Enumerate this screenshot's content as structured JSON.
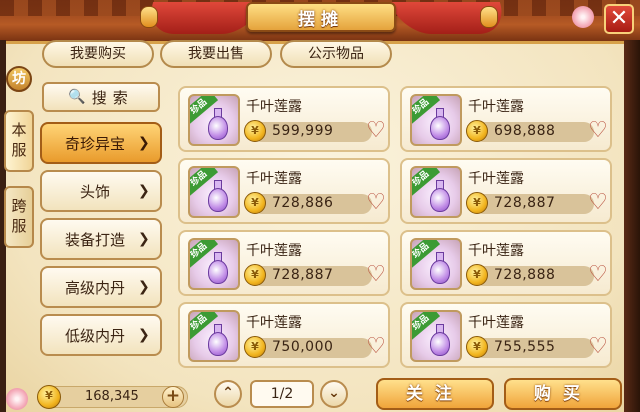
{
  "window": {
    "title": "摆摊",
    "close": "✕"
  },
  "top_tabs": [
    {
      "label": "我要购买"
    },
    {
      "label": "我要出售"
    },
    {
      "label": "公示物品"
    }
  ],
  "side_tabs": {
    "badge": "坊",
    "server": "本服",
    "cross_server": "跨服"
  },
  "search": {
    "label": "搜索"
  },
  "categories": [
    {
      "label": "奇珍异宝",
      "active": true
    },
    {
      "label": "头饰",
      "active": false
    },
    {
      "label": "装备打造",
      "active": false
    },
    {
      "label": "高级内丹",
      "active": false
    },
    {
      "label": "低级内丹",
      "active": false
    }
  ],
  "items": [
    {
      "name": "千叶莲露",
      "tag": "珍品",
      "price": "599,999"
    },
    {
      "name": "千叶莲露",
      "tag": "珍品",
      "price": "698,888"
    },
    {
      "name": "千叶莲露",
      "tag": "珍品",
      "price": "728,886"
    },
    {
      "name": "千叶莲露",
      "tag": "珍品",
      "price": "728,887"
    },
    {
      "name": "千叶莲露",
      "tag": "珍品",
      "price": "728,887"
    },
    {
      "name": "千叶莲露",
      "tag": "珍品",
      "price": "728,888"
    },
    {
      "name": "千叶莲露",
      "tag": "珍品",
      "price": "750,000"
    },
    {
      "name": "千叶莲露",
      "tag": "珍品",
      "price": "755,555"
    }
  ],
  "footer": {
    "money": "168,345",
    "page": "1/2",
    "follow_label": "关注",
    "buy_label": "购买"
  },
  "colors": {
    "accent": "#f0a43a",
    "heart": "#b9523f",
    "tag": "#3c9b34"
  }
}
